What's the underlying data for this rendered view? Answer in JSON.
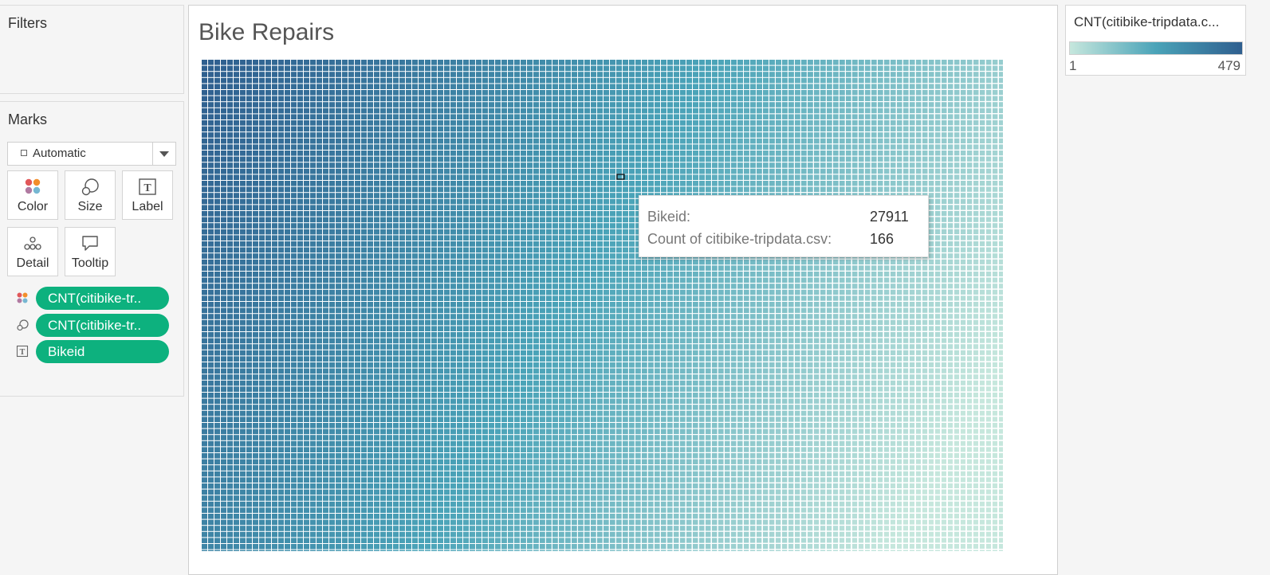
{
  "filters": {
    "title": "Filters"
  },
  "marks": {
    "title": "Marks",
    "mark_type": "Automatic",
    "buttons": [
      {
        "label": "Color",
        "icon": "color-dots-icon"
      },
      {
        "label": "Size",
        "icon": "size-icon"
      },
      {
        "label": "Label",
        "icon": "label-icon"
      },
      {
        "label": "Detail",
        "icon": "detail-dots-icon"
      },
      {
        "label": "Tooltip",
        "icon": "tooltip-bubble-icon"
      }
    ],
    "pills": [
      {
        "label": "CNT(citibike-tr..",
        "icon": "color-dots-icon"
      },
      {
        "label": "CNT(citibike-tr..",
        "icon": "size-icon"
      },
      {
        "label": "Bikeid",
        "icon": "label-icon"
      }
    ]
  },
  "view": {
    "title": "Bike Repairs",
    "tooltip": {
      "key1": "Bikeid:",
      "value1": "27911",
      "key2": "Count of citibike-tripdata.csv:",
      "value2": "166"
    }
  },
  "legend": {
    "title": "CNT(citibike-tripdata.c...",
    "min_label": "1",
    "max_label": "479",
    "color_low": "#c6e7dd",
    "color_mid": "#4aa3b8",
    "color_high": "#2f5f8f"
  },
  "colors": {
    "pill": "#0db17e",
    "treemap_high": "#2f5f8f",
    "treemap_mid": "#4aa3b8",
    "treemap_low": "#c6e7dd"
  },
  "chart_data": {
    "type": "treemap",
    "title": "Bike Repairs",
    "measure": "CNT(citibike-tripdata.csv)",
    "dimension": "Bikeid",
    "value_range": [
      1,
      479
    ],
    "highlighted": {
      "Bikeid": 27911,
      "count": 166
    }
  }
}
